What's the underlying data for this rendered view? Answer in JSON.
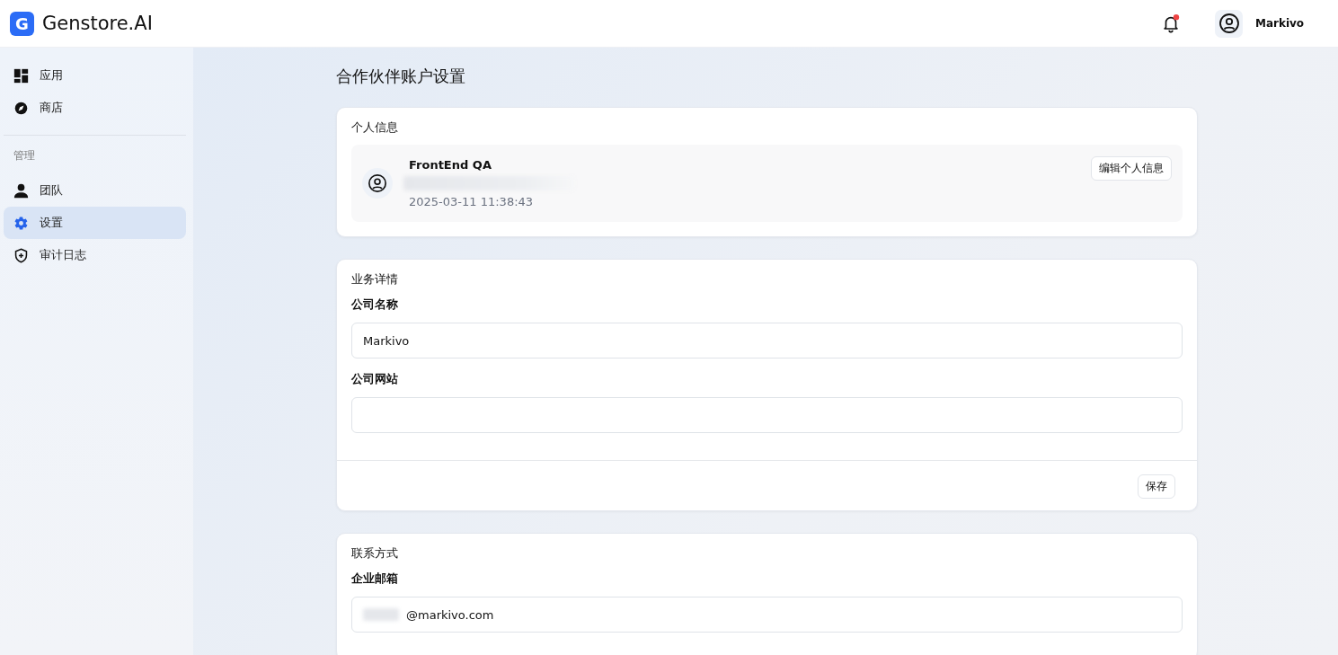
{
  "header": {
    "logo_letter": "G",
    "brand": "Genstore.AI",
    "notification_dot": true,
    "user_name": "Markivo"
  },
  "sidebar": {
    "items": [
      {
        "label": "应用",
        "kind": "grid",
        "selected": false
      },
      {
        "label": "商店",
        "kind": "compass",
        "selected": false
      }
    ],
    "section_label": "管理",
    "section_items": [
      {
        "label": "团队",
        "kind": "person",
        "selected": false
      },
      {
        "label": "设置",
        "kind": "gear",
        "selected": true
      },
      {
        "label": "审计日志",
        "kind": "shield",
        "selected": false
      }
    ]
  },
  "page_title": "合作伙伴账户设置",
  "personal": {
    "title": "个人信息",
    "name": "FrontEnd QA",
    "timestamp": "2025-03-11 11:38:43",
    "edit_button": "编辑个人信息"
  },
  "business": {
    "title": "业务详情",
    "fields": [
      {
        "label": "公司名称",
        "value": "Markivo"
      },
      {
        "label": "公司网站"
      }
    ],
    "save_button": "保存"
  },
  "contact": {
    "title": "联系方式",
    "fields": [
      {
        "label": "企业邮箱",
        "value": "@markivo.com",
        "redacted_prefix": true
      }
    ]
  }
}
